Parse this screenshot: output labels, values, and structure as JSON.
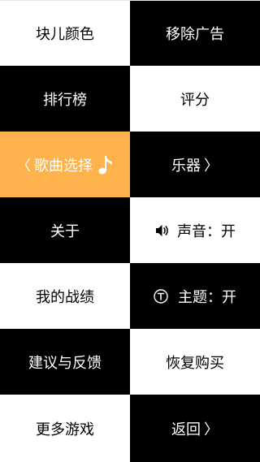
{
  "menu": {
    "block_color": "块儿颜色",
    "remove_ads": "移除广告",
    "leaderboard": "排行榜",
    "rate": "评分",
    "choose_song": "歌曲选择",
    "instruments": "乐器",
    "about": "关于",
    "sound": "声音：开",
    "my_record": "我的战绩",
    "theme": "主题：开",
    "feedback": "建议与反馈",
    "restore_purchase": "恢复购买",
    "more_games": "更多游戏",
    "back": "返回"
  },
  "glyphs": {
    "chevron_left": "〈",
    "chevron_right": "〉"
  },
  "colors": {
    "white": "#ffffff",
    "black": "#000000",
    "accent_orange": "#fdb24b"
  },
  "icons": {
    "note": "music-note-icon",
    "speaker": "speaker-icon",
    "theme": "t-circle-icon",
    "chevron_left": "chevron-left-icon",
    "chevron_right": "chevron-right-icon"
  }
}
